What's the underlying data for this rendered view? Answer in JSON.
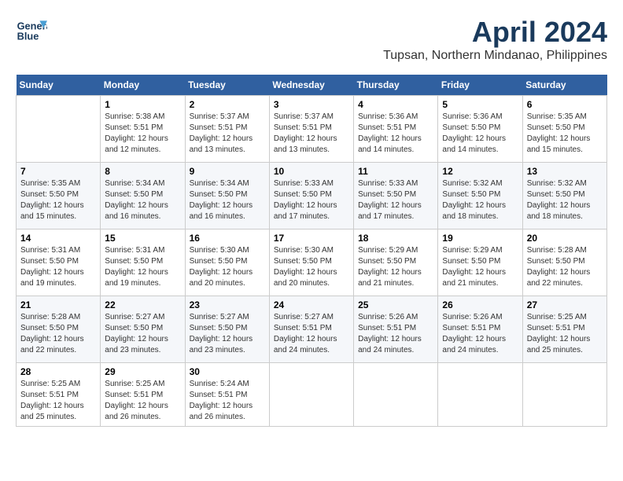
{
  "header": {
    "logo_line1": "General",
    "logo_line2": "Blue",
    "month_title": "April 2024",
    "location": "Tupsan, Northern Mindanao, Philippines"
  },
  "calendar": {
    "days_of_week": [
      "Sunday",
      "Monday",
      "Tuesday",
      "Wednesday",
      "Thursday",
      "Friday",
      "Saturday"
    ],
    "weeks": [
      [
        {
          "day": "",
          "info": ""
        },
        {
          "day": "1",
          "info": "Sunrise: 5:38 AM\nSunset: 5:51 PM\nDaylight: 12 hours\nand 12 minutes."
        },
        {
          "day": "2",
          "info": "Sunrise: 5:37 AM\nSunset: 5:51 PM\nDaylight: 12 hours\nand 13 minutes."
        },
        {
          "day": "3",
          "info": "Sunrise: 5:37 AM\nSunset: 5:51 PM\nDaylight: 12 hours\nand 13 minutes."
        },
        {
          "day": "4",
          "info": "Sunrise: 5:36 AM\nSunset: 5:51 PM\nDaylight: 12 hours\nand 14 minutes."
        },
        {
          "day": "5",
          "info": "Sunrise: 5:36 AM\nSunset: 5:50 PM\nDaylight: 12 hours\nand 14 minutes."
        },
        {
          "day": "6",
          "info": "Sunrise: 5:35 AM\nSunset: 5:50 PM\nDaylight: 12 hours\nand 15 minutes."
        }
      ],
      [
        {
          "day": "7",
          "info": "Sunrise: 5:35 AM\nSunset: 5:50 PM\nDaylight: 12 hours\nand 15 minutes."
        },
        {
          "day": "8",
          "info": "Sunrise: 5:34 AM\nSunset: 5:50 PM\nDaylight: 12 hours\nand 16 minutes."
        },
        {
          "day": "9",
          "info": "Sunrise: 5:34 AM\nSunset: 5:50 PM\nDaylight: 12 hours\nand 16 minutes."
        },
        {
          "day": "10",
          "info": "Sunrise: 5:33 AM\nSunset: 5:50 PM\nDaylight: 12 hours\nand 17 minutes."
        },
        {
          "day": "11",
          "info": "Sunrise: 5:33 AM\nSunset: 5:50 PM\nDaylight: 12 hours\nand 17 minutes."
        },
        {
          "day": "12",
          "info": "Sunrise: 5:32 AM\nSunset: 5:50 PM\nDaylight: 12 hours\nand 18 minutes."
        },
        {
          "day": "13",
          "info": "Sunrise: 5:32 AM\nSunset: 5:50 PM\nDaylight: 12 hours\nand 18 minutes."
        }
      ],
      [
        {
          "day": "14",
          "info": "Sunrise: 5:31 AM\nSunset: 5:50 PM\nDaylight: 12 hours\nand 19 minutes."
        },
        {
          "day": "15",
          "info": "Sunrise: 5:31 AM\nSunset: 5:50 PM\nDaylight: 12 hours\nand 19 minutes."
        },
        {
          "day": "16",
          "info": "Sunrise: 5:30 AM\nSunset: 5:50 PM\nDaylight: 12 hours\nand 20 minutes."
        },
        {
          "day": "17",
          "info": "Sunrise: 5:30 AM\nSunset: 5:50 PM\nDaylight: 12 hours\nand 20 minutes."
        },
        {
          "day": "18",
          "info": "Sunrise: 5:29 AM\nSunset: 5:50 PM\nDaylight: 12 hours\nand 21 minutes."
        },
        {
          "day": "19",
          "info": "Sunrise: 5:29 AM\nSunset: 5:50 PM\nDaylight: 12 hours\nand 21 minutes."
        },
        {
          "day": "20",
          "info": "Sunrise: 5:28 AM\nSunset: 5:50 PM\nDaylight: 12 hours\nand 22 minutes."
        }
      ],
      [
        {
          "day": "21",
          "info": "Sunrise: 5:28 AM\nSunset: 5:50 PM\nDaylight: 12 hours\nand 22 minutes."
        },
        {
          "day": "22",
          "info": "Sunrise: 5:27 AM\nSunset: 5:50 PM\nDaylight: 12 hours\nand 23 minutes."
        },
        {
          "day": "23",
          "info": "Sunrise: 5:27 AM\nSunset: 5:50 PM\nDaylight: 12 hours\nand 23 minutes."
        },
        {
          "day": "24",
          "info": "Sunrise: 5:27 AM\nSunset: 5:51 PM\nDaylight: 12 hours\nand 24 minutes."
        },
        {
          "day": "25",
          "info": "Sunrise: 5:26 AM\nSunset: 5:51 PM\nDaylight: 12 hours\nand 24 minutes."
        },
        {
          "day": "26",
          "info": "Sunrise: 5:26 AM\nSunset: 5:51 PM\nDaylight: 12 hours\nand 24 minutes."
        },
        {
          "day": "27",
          "info": "Sunrise: 5:25 AM\nSunset: 5:51 PM\nDaylight: 12 hours\nand 25 minutes."
        }
      ],
      [
        {
          "day": "28",
          "info": "Sunrise: 5:25 AM\nSunset: 5:51 PM\nDaylight: 12 hours\nand 25 minutes."
        },
        {
          "day": "29",
          "info": "Sunrise: 5:25 AM\nSunset: 5:51 PM\nDaylight: 12 hours\nand 26 minutes."
        },
        {
          "day": "30",
          "info": "Sunrise: 5:24 AM\nSunset: 5:51 PM\nDaylight: 12 hours\nand 26 minutes."
        },
        {
          "day": "",
          "info": ""
        },
        {
          "day": "",
          "info": ""
        },
        {
          "day": "",
          "info": ""
        },
        {
          "day": "",
          "info": ""
        }
      ]
    ]
  }
}
